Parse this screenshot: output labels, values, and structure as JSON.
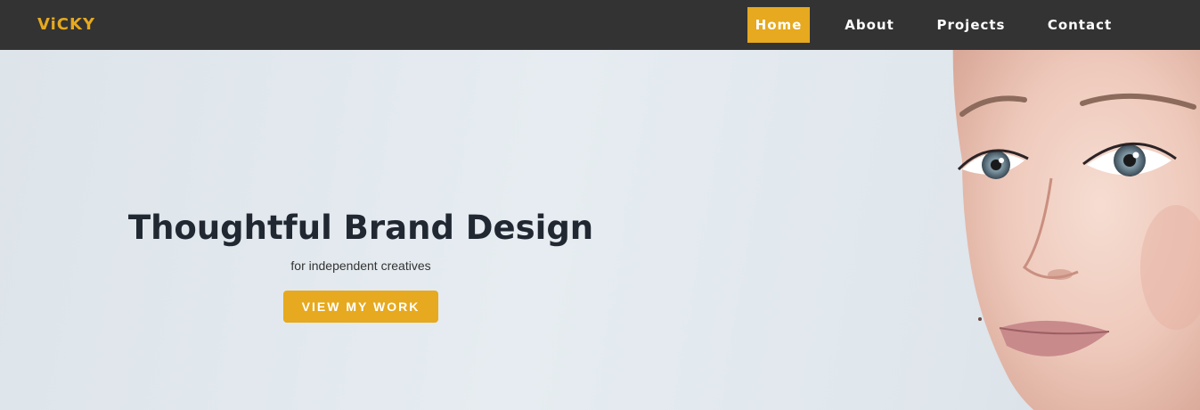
{
  "brand": {
    "name": "ViCKY",
    "accent_color": "#e6a91f"
  },
  "nav": {
    "items": [
      {
        "label": "Home",
        "active": true
      },
      {
        "label": "About",
        "active": false
      },
      {
        "label": "Projects",
        "active": false
      },
      {
        "label": "Contact",
        "active": false
      }
    ],
    "background_color": "#333333"
  },
  "hero": {
    "title": "Thoughtful Brand Design",
    "subtitle": "for independent creatives",
    "cta_label": "VIEW MY WORK",
    "image": "woman-portrait"
  }
}
